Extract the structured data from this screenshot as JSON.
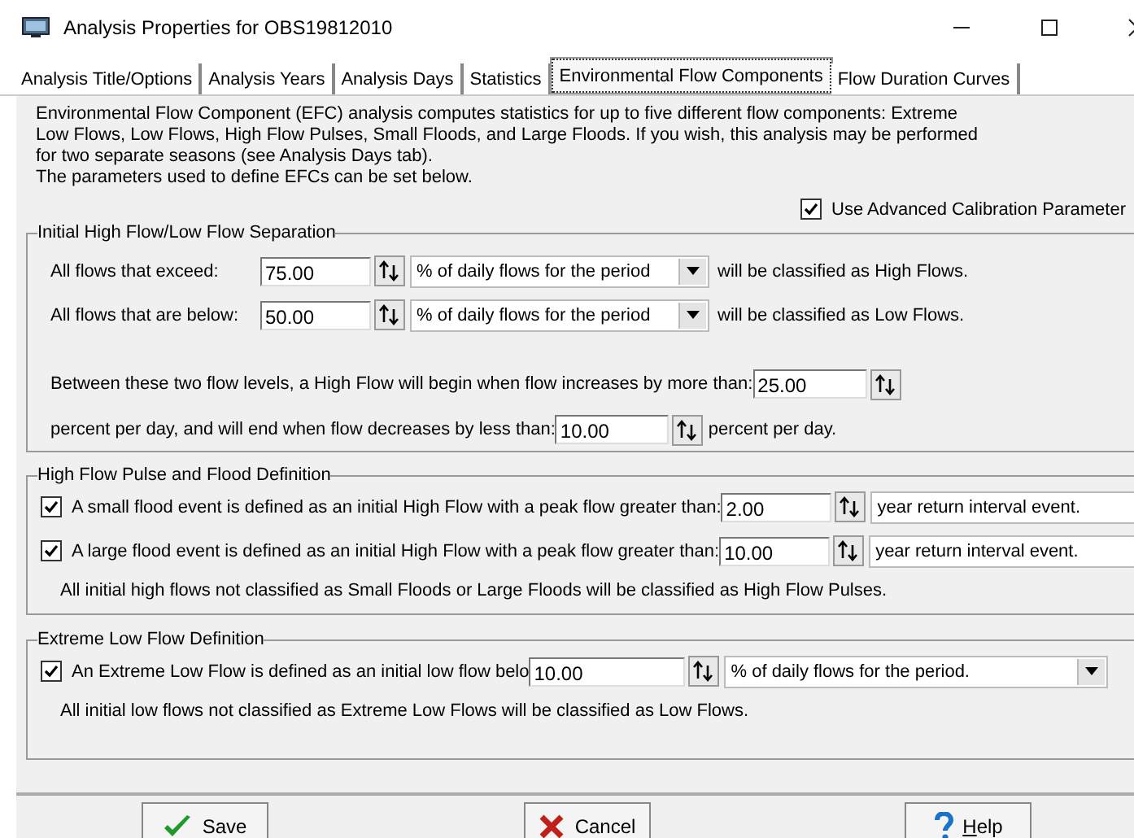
{
  "window": {
    "title": "Analysis Properties for OBS19812010"
  },
  "tabs": [
    {
      "label": "Analysis Title/Options",
      "selected": false
    },
    {
      "label": "Analysis Years",
      "selected": false
    },
    {
      "label": "Analysis Days",
      "selected": false
    },
    {
      "label": "Statistics",
      "selected": false
    },
    {
      "label": "Environmental Flow Components",
      "selected": true
    },
    {
      "label": "Flow Duration Curves",
      "selected": false
    }
  ],
  "description": "Environmental Flow Component (EFC) analysis computes statistics for up to five different flow components: Extreme\nLow Flows, Low Flows, High Flow Pulses, Small Floods, and Large Floods.  If you wish, this analysis may be performed\nfor two separate seasons (see Analysis Days tab).\nThe parameters used to define EFCs can be set below.",
  "advanced_calibration": {
    "label": "Use Advanced Calibration Parameter",
    "checked": true
  },
  "separation": {
    "title": "Initial High Flow/Low Flow Separation",
    "thresholds": [
      {
        "label": "All flows that exceed:",
        "value": "75.00",
        "unit": "% of daily flows for the period",
        "suffix": "will be classified as High Flows."
      },
      {
        "label": "All flows that are below:",
        "value": "50.00",
        "unit": "% of daily flows for the period",
        "suffix": "will be classified as Low Flows."
      }
    ],
    "rise": {
      "label": "Between these two flow levels, a High Flow will begin when flow increases by more than:",
      "value": "25.00"
    },
    "fall": {
      "label": "percent per day, and will end when flow decreases by less than:",
      "value": "10.00",
      "suffix": "percent per day."
    }
  },
  "floods": {
    "title": "High Flow Pulse and Flood Definition",
    "events": [
      {
        "checked": true,
        "label": "A small flood event is defined as an initial High Flow with a peak flow greater than:",
        "value": "2.00",
        "unit": "year return interval event."
      },
      {
        "checked": true,
        "label": "A large flood event is defined as an initial High Flow with a peak flow greater than:",
        "value": "10.00",
        "unit": "year return interval event."
      }
    ],
    "note": "All initial high flows not classified as Small Floods or Large Floods will be classified as High Flow Pulses."
  },
  "extreme_low": {
    "title": "Extreme Low Flow Definition",
    "event": {
      "checked": true,
      "label": "An Extreme Low Flow is defined as an initial low flow belo",
      "value": "10.00",
      "unit": "% of daily flows for the period."
    },
    "note": "All initial low flows not classified as Extreme Low Flows will be classified as Low Flows."
  },
  "buttons": [
    {
      "kind": "save",
      "label": "Save"
    },
    {
      "kind": "cancel",
      "label": "Cancel"
    },
    {
      "kind": "help",
      "label": "Help"
    }
  ]
}
